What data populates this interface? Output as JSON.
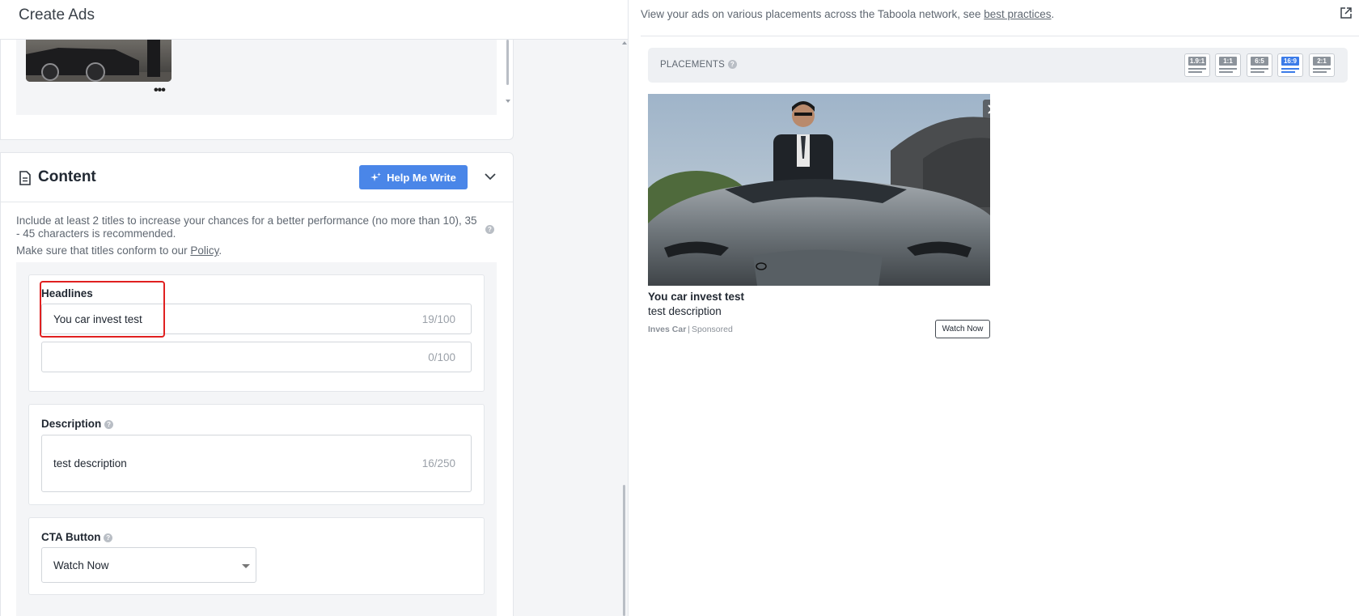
{
  "header": {
    "title": "Create Ads"
  },
  "media": {
    "more_label": "•••"
  },
  "content": {
    "title": "Content",
    "help_button_label": "Help Me Write",
    "info_text": "Include at least 2 titles to increase your chances for a better performance (no more than 10), 35 - 45 characters is recommended.",
    "policy_prefix": "Make sure that titles conform to our ",
    "policy_link": "Policy",
    "policy_suffix": ".",
    "help_glyph": "?"
  },
  "headlines": {
    "label": "Headlines",
    "items": [
      {
        "value": "You car invest test",
        "counter": "19/100"
      },
      {
        "value": "",
        "counter": "0/100"
      }
    ]
  },
  "description": {
    "label": "Description",
    "value": "test description",
    "counter": "16/250"
  },
  "cta": {
    "label": "CTA Button",
    "selected": "Watch Now"
  },
  "preview": {
    "note_prefix": "View your ads on various placements across the Taboola network, see ",
    "note_link": "best practices",
    "note_suffix": ".",
    "placements_label": "PLACEMENTS",
    "ratios": [
      {
        "label": "1.9:1",
        "active": false
      },
      {
        "label": "1:1",
        "active": false
      },
      {
        "label": "6:5",
        "active": false
      },
      {
        "label": "16:9",
        "active": true
      },
      {
        "label": "2:1",
        "active": false
      }
    ],
    "ad": {
      "title": "You car invest test",
      "description": "test description",
      "brand": "Inves Car",
      "separator": "|",
      "sponsored": "Sponsored",
      "cta": "Watch Now"
    }
  },
  "colors": {
    "accent": "#4a86e8",
    "active_ratio": "#3b7be8",
    "highlight_border": "#e02020",
    "panel_bg": "#f4f5f7"
  }
}
